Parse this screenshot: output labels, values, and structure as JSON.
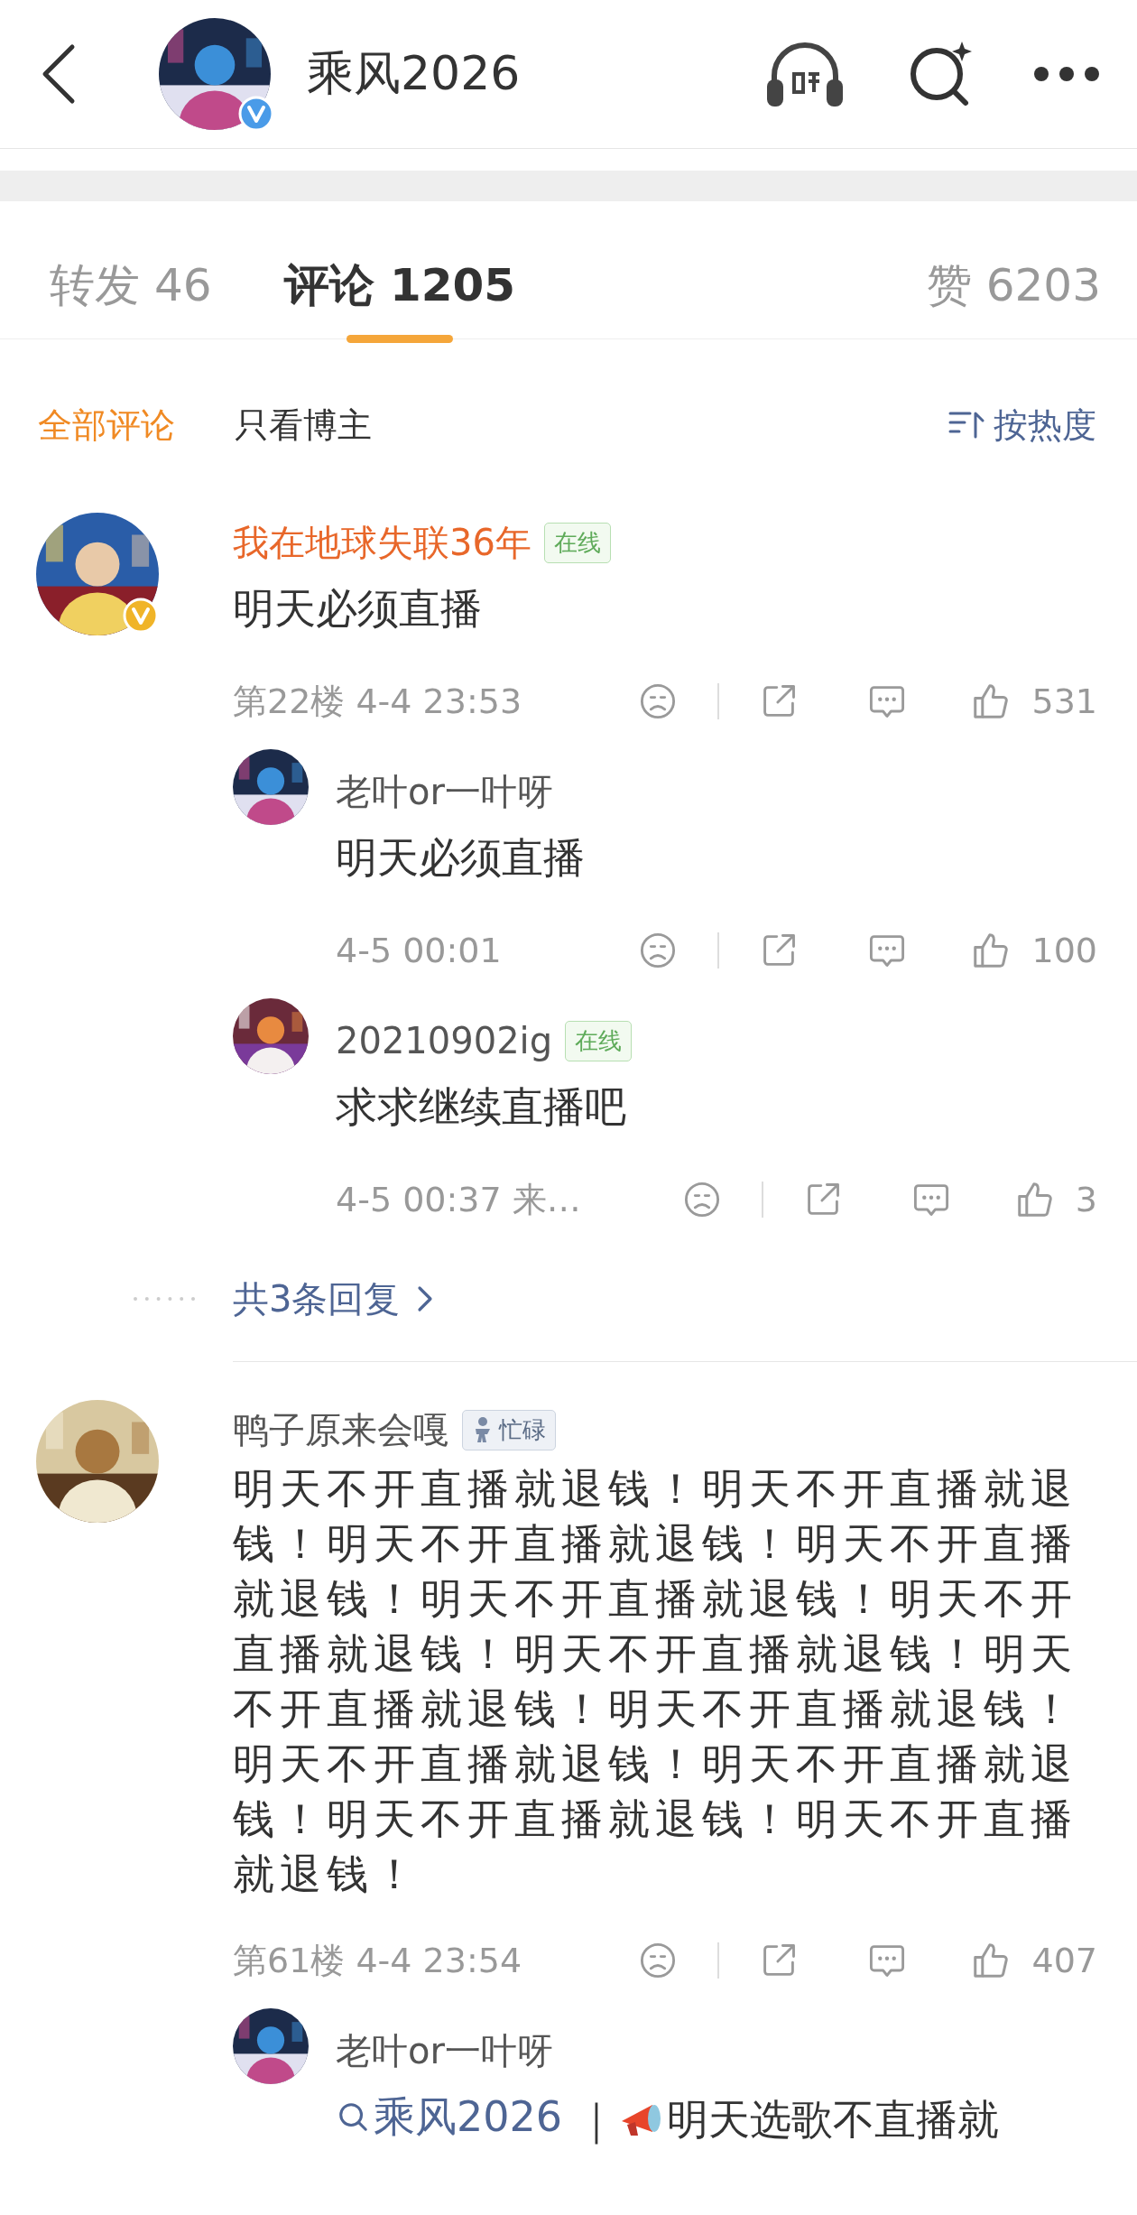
{
  "header": {
    "title": "乘风2026",
    "verified": true
  },
  "tabs": [
    {
      "label": "转发",
      "count": "46",
      "selected": false
    },
    {
      "label": "评论",
      "count": "1205",
      "selected": true
    },
    {
      "label": "赞",
      "count": "6203",
      "selected": false
    }
  ],
  "filters": [
    {
      "label": "全部评论",
      "selected": true
    },
    {
      "label": "只看博主",
      "selected": false
    }
  ],
  "sort": {
    "label": "按热度"
  },
  "comments": [
    {
      "name": "我在地球失联36年",
      "vip": true,
      "verified": true,
      "badge": {
        "kind": "online",
        "label": "在线"
      },
      "text": "明天必须直播",
      "meta": "第22楼 4-4 23:53",
      "likes": "531",
      "replies": [
        {
          "name": "老叶or一叶呀",
          "parts": [
            {
              "kind": "plain",
              "text": "明天必须直播"
            }
          ],
          "meta": "4-5 00:01",
          "likes": "100"
        },
        {
          "name": "20210902ig",
          "badge": {
            "kind": "online",
            "label": "在线"
          },
          "parts": [
            {
              "kind": "plain",
              "text": "求求继续直播吧"
            }
          ],
          "meta": "4-5 00:37 来…",
          "likes": "3"
        }
      ],
      "more_replies": "共3条回复"
    },
    {
      "name": "鸭子原来会嘎",
      "vip": false,
      "verified": false,
      "badge": {
        "kind": "busy",
        "label": "忙碌"
      },
      "text": "明天不开直播就退钱！明天不开直播就退钱！明天不开直播就退钱！明天不开直播就退钱！明天不开直播就退钱！明天不开直播就退钱！明天不开直播就退钱！明天不开直播就退钱！明天不开直播就退钱！明天不开直播就退钱！明天不开直播就退钱！明天不开直播就退钱！明天不开直播就退钱！",
      "meta": "第61楼 4-4 23:54",
      "likes": "407",
      "replies": [
        {
          "name": "老叶or一叶呀",
          "parts": [
            {
              "kind": "topic",
              "text": "乘风2026"
            },
            {
              "kind": "plain",
              "text": " ｜"
            },
            {
              "kind": "megaphone"
            },
            {
              "kind": "plain",
              "text": "明天选歌不直播就"
            }
          ]
        }
      ]
    }
  ]
}
